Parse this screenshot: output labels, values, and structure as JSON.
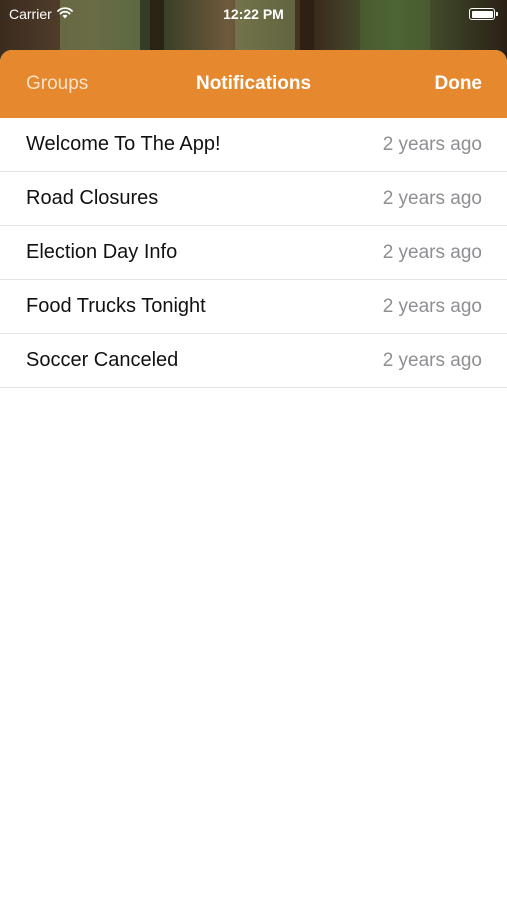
{
  "status_bar": {
    "carrier": "Carrier",
    "time": "12:22 PM"
  },
  "navbar": {
    "left_label": "Groups",
    "title": "Notifications",
    "right_label": "Done",
    "accent_color": "#e6882e"
  },
  "notifications": [
    {
      "title": "Welcome To The App!",
      "time": "2 years ago"
    },
    {
      "title": "Road Closures",
      "time": "2 years ago"
    },
    {
      "title": "Election Day Info",
      "time": "2 years ago"
    },
    {
      "title": "Food Trucks Tonight",
      "time": "2 years ago"
    },
    {
      "title": "Soccer Canceled",
      "time": "2 years ago"
    }
  ],
  "icons": {
    "wifi": "wifi-icon",
    "battery": "battery-icon"
  }
}
